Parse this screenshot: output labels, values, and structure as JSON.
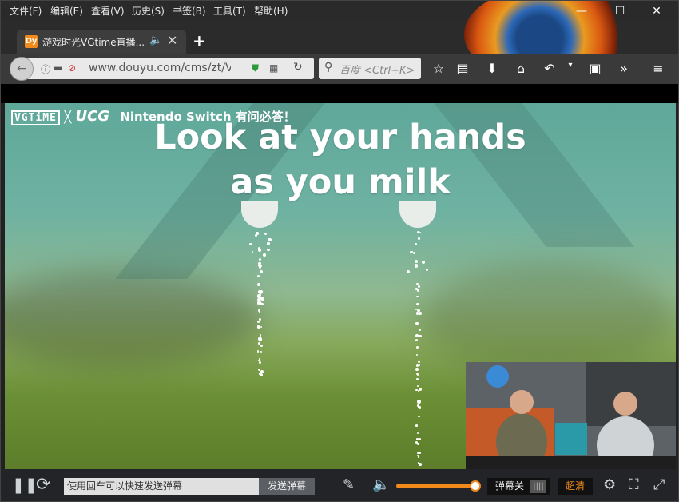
{
  "menubar": {
    "items": [
      "文件(F)",
      "编辑(E)",
      "查看(V)",
      "历史(S)",
      "书签(B)",
      "工具(T)",
      "帮助(H)"
    ]
  },
  "window_controls": {
    "minimize": "—",
    "maximize": "☐",
    "close": "✕"
  },
  "tab": {
    "favicon_text": "Dy",
    "title": "游戏时光VGtime直播..."
  },
  "navbar": {
    "url": "www.douyu.com/cms/zt/VG",
    "search_placeholder": "百度 <Ctrl+K>"
  },
  "video": {
    "brand_vgtime": "VGTiME",
    "brand_cross": "╳",
    "brand_ucg": "UCG",
    "brand_subtitle": "Nintendo Switch 有问必答！",
    "headline_line1": "Look at your hands",
    "headline_line2": "as you milk"
  },
  "controls": {
    "danmu_placeholder": "使用回车可以快速发送弹幕",
    "send_label": "发送弹幕",
    "danmu_toggle_label": "弹幕关",
    "quality_label": "超清",
    "volume_level": 0.97
  },
  "colors": {
    "accent": "#f08a1a",
    "video_sky": "#5fa89a",
    "video_grass": "#6b8f36",
    "control_bg": "#222427"
  }
}
